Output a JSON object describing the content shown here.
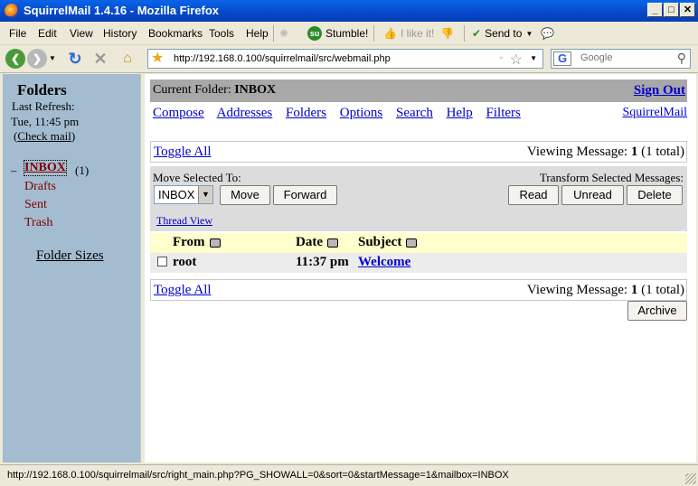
{
  "window": {
    "title": "SquirrelMail 1.4.16 - Mozilla Firefox",
    "min": "_",
    "max": "□",
    "close": "✕"
  },
  "menubar": {
    "items": [
      "File",
      "Edit",
      "View",
      "History",
      "Bookmarks",
      "Tools",
      "Help"
    ],
    "stumble": "Stumble!",
    "ilike": "I like it!",
    "sendto": "Send to"
  },
  "navbar": {
    "url": "http://192.168.0.100/squirrelmail/src/webmail.php",
    "search_placeholder": "Google"
  },
  "sidebar": {
    "heading": "Folders",
    "last_refresh_label": "Last Refresh:",
    "last_refresh_time": "Tue, 11:45 pm",
    "check_mail": "Check mail",
    "collapse": "–",
    "folders": [
      {
        "name": "INBOX",
        "count": "(1)"
      },
      {
        "name": "Drafts"
      },
      {
        "name": "Sent"
      },
      {
        "name": "Trash"
      }
    ],
    "folder_sizes": "Folder Sizes"
  },
  "main": {
    "current_folder_label": "Current Folder:",
    "current_folder": "INBOX",
    "sign_out": "Sign Out",
    "nav": [
      "Compose",
      "Addresses",
      "Folders",
      "Options",
      "Search",
      "Help",
      "Filters"
    ],
    "squirrelmail_link": "SquirrelMail",
    "toggle_all": "Toggle All",
    "viewing_label": "Viewing Message:",
    "viewing_num": "1",
    "viewing_total": "(1 total)",
    "move_selected_label": "Move Selected To:",
    "move_target": "INBOX",
    "move_button": "Move",
    "forward_button": "Forward",
    "transform_label": "Transform Selected Messages:",
    "read_button": "Read",
    "unread_button": "Unread",
    "delete_button": "Delete",
    "thread_view": "Thread View",
    "columns": {
      "from": "From",
      "date": "Date",
      "subject": "Subject"
    },
    "messages": [
      {
        "from": "root",
        "date": "11:37 pm",
        "subject": "Welcome"
      }
    ],
    "archive_button": "Archive"
  },
  "status": {
    "text": "http://192.168.0.100/squirrelmail/src/right_main.php?PG_SHOWALL=0&sort=0&startMessage=1&mailbox=INBOX"
  }
}
